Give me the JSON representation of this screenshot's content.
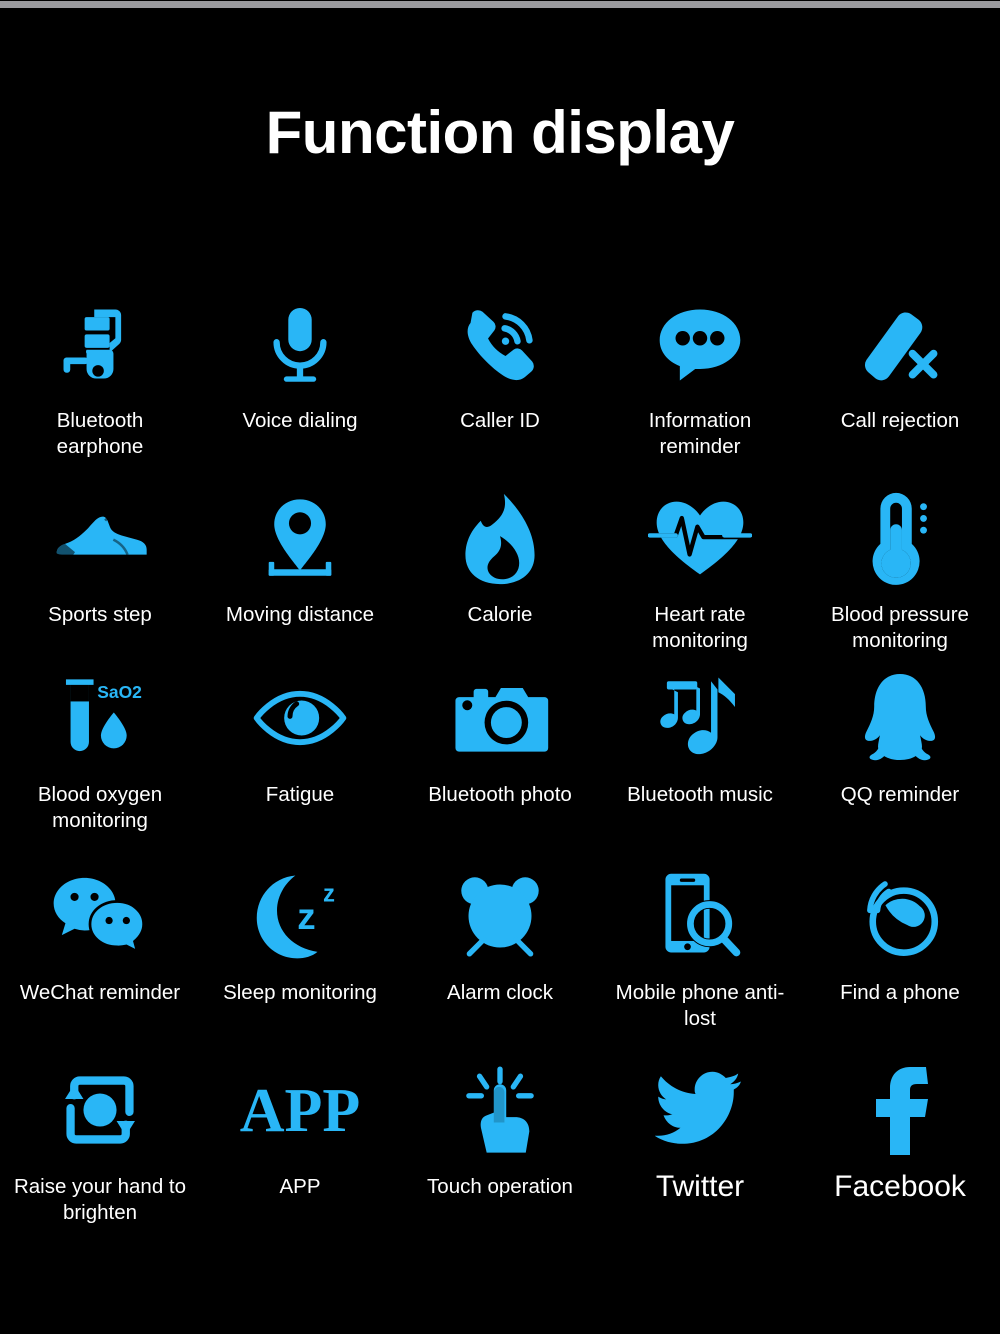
{
  "page": {
    "title": "Function display",
    "background_color": "#000000",
    "accent_color": "#29B6F6",
    "text_color": "#FFFFFF",
    "top_bar_color": "#9A9A9E"
  },
  "features": [
    [
      {
        "label": "Bluetooth earphone",
        "icon": "bluetooth-earphone-icon"
      },
      {
        "label": "Voice dialing",
        "icon": "microphone-icon"
      },
      {
        "label": "Caller ID",
        "icon": "incoming-call-icon"
      },
      {
        "label": "Information reminder",
        "icon": "chat-bubble-ellipsis-icon"
      },
      {
        "label": "Call rejection",
        "icon": "call-reject-icon"
      }
    ],
    [
      {
        "label": "Sports step",
        "icon": "sneaker-icon"
      },
      {
        "label": "Moving distance",
        "icon": "map-pin-distance-icon"
      },
      {
        "label": "Calorie",
        "icon": "flame-icon"
      },
      {
        "label": "Heart rate monitoring",
        "icon": "heart-pulse-icon"
      },
      {
        "label": "Blood pressure monitoring",
        "icon": "thermometer-icon"
      }
    ],
    [
      {
        "label": "Blood oxygen monitoring",
        "icon": "test-tube-sao2-icon",
        "icon_text": "SaO2"
      },
      {
        "label": "Fatigue",
        "icon": "eye-icon"
      },
      {
        "label": "Bluetooth photo",
        "icon": "camera-icon"
      },
      {
        "label": "Bluetooth music",
        "icon": "music-notes-icon"
      },
      {
        "label": "QQ reminder",
        "icon": "qq-penguin-icon"
      }
    ],
    [
      {
        "label": "WeChat reminder",
        "icon": "wechat-bubbles-icon"
      },
      {
        "label": "Sleep monitoring",
        "icon": "moon-zzz-icon"
      },
      {
        "label": "Alarm clock",
        "icon": "alarm-clock-icon"
      },
      {
        "label": "Mobile phone anti-lost",
        "icon": "phone-search-icon"
      },
      {
        "label": "Find a phone",
        "icon": "find-phone-ring-icon"
      }
    ],
    [
      {
        "label": "Raise your hand to brighten",
        "icon": "rotate-square-icon"
      },
      {
        "label": "APP",
        "icon": "app-text-icon",
        "icon_text": "APP"
      },
      {
        "label": "Touch operation",
        "icon": "tap-hand-icon"
      },
      {
        "label": "Twitter",
        "icon": "twitter-bird-icon",
        "large_label": true
      },
      {
        "label": "Facebook",
        "icon": "facebook-f-icon",
        "large_label": true
      }
    ]
  ]
}
